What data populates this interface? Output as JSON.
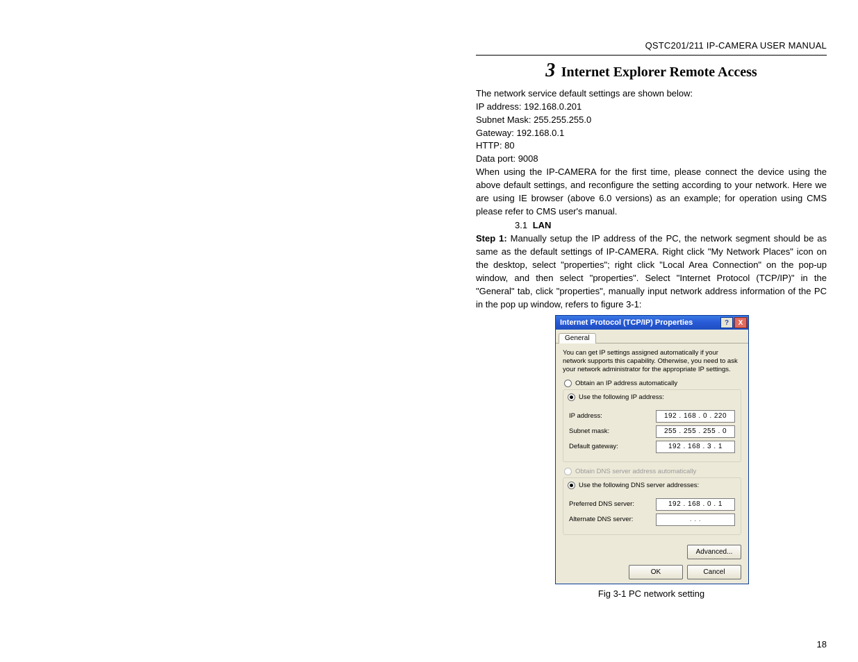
{
  "header": {
    "title": "QSTC201/211 IP-CAMERA USER MANUAL"
  },
  "chapter": {
    "number": "3",
    "title": "Internet Explorer Remote Access"
  },
  "intro": {
    "line1": "The network service default settings are shown below:",
    "ip": "IP address: 192.168.0.201",
    "mask": "Subnet Mask: 255.255.255.0",
    "gw": "Gateway: 192.168.0.1",
    "http": "HTTP: 80",
    "dataport": "Data port: 9008",
    "para2": "When using the IP-CAMERA for the first time, please connect the device using the above default settings, and reconfigure the setting according to your network. Here we are using IE browser (above 6.0 versions) as an example; for operation using CMS please refer to CMS user's manual."
  },
  "section": {
    "number": "3.1",
    "title": "LAN"
  },
  "step1": {
    "label": "Step 1:",
    "text": " Manually setup the IP address of the PC, the network segment should be as same as the default settings of IP-CAMERA. Right click \"My Network Places\" icon on the desktop, select \"properties\"; right click \"Local Area Connection\" on the pop-up window, and then select \"properties\". Select \"Internet Protocol (TCP/IP)\" in the \"General\" tab, click \"properties\", manually input network address information of the PC in the pop up window, refers to figure 3-1:"
  },
  "dialog": {
    "title": "Internet Protocol (TCP/IP) Properties",
    "help": "?",
    "close": "X",
    "tab": "General",
    "info": "You can get IP settings assigned automatically if your network supports this capability. Otherwise, you need to ask your network administrator for the appropriate IP settings.",
    "radio_auto_ip": "Obtain an IP address automatically",
    "radio_use_ip": "Use the following IP address:",
    "lbl_ip": "IP address:",
    "val_ip": "192 . 168 .  0  . 220",
    "lbl_mask": "Subnet mask:",
    "val_mask": "255 . 255 . 255 .  0",
    "lbl_gw": "Default gateway:",
    "val_gw": "192 . 168 .  3  .  1",
    "radio_auto_dns": "Obtain DNS server address automatically",
    "radio_use_dns": "Use the following DNS server addresses:",
    "lbl_pdns": "Preferred DNS server:",
    "val_pdns": "192 . 168 .  0  .  1",
    "lbl_adns": "Alternate DNS server:",
    "val_adns": ".     .     .",
    "btn_adv": "Advanced...",
    "btn_ok": "OK",
    "btn_cancel": "Cancel"
  },
  "caption": "Fig 3-1 PC network setting",
  "page_number": "18"
}
